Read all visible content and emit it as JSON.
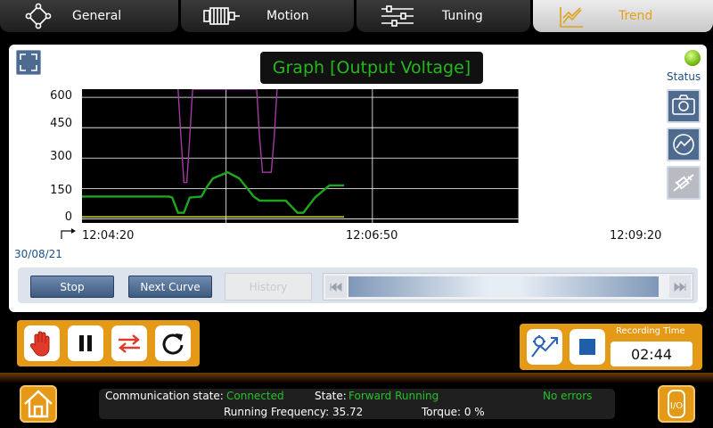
{
  "tabs": [
    {
      "label": "General",
      "icon": "network-icon"
    },
    {
      "label": "Motion",
      "icon": "motor-icon"
    },
    {
      "label": "Tuning",
      "icon": "sliders-icon"
    },
    {
      "label": "Trend",
      "icon": "trend-icon",
      "active": true
    }
  ],
  "graph": {
    "title": "Graph [Output Voltage]",
    "status_label": "Status",
    "date": "30/08/21"
  },
  "chart_data": {
    "type": "line",
    "yticks": [
      0,
      150,
      300,
      450,
      600
    ],
    "xticks": [
      "12:04:20",
      "12:06:50",
      "12:09:20"
    ],
    "ylim": [
      -20,
      640
    ],
    "xlim": [
      0,
      300
    ],
    "grid": true,
    "series": [
      {
        "color": "#1fa51f",
        "x": [
          0,
          60,
          62,
          66,
          70,
          74,
          82,
          86,
          90,
          100,
          108,
          118,
          122,
          132,
          140,
          148,
          152,
          160,
          170,
          180
        ],
        "y": [
          110,
          110,
          105,
          30,
          30,
          105,
          110,
          160,
          200,
          230,
          200,
          110,
          90,
          90,
          90,
          30,
          30,
          105,
          165,
          165
        ]
      },
      {
        "color": "#a43aa5",
        "x": [
          66,
          68,
          70,
          72,
          74,
          76,
          120,
          122,
          124,
          126,
          128,
          130,
          132,
          134
        ],
        "y": [
          640,
          400,
          180,
          180,
          400,
          640,
          640,
          400,
          230,
          230,
          230,
          230,
          400,
          640
        ]
      },
      {
        "color": "#e8e830",
        "x": [
          0,
          180
        ],
        "y": [
          10,
          10
        ]
      }
    ]
  },
  "controls": {
    "stop": "Stop",
    "next_curve": "Next Curve",
    "history": "History"
  },
  "recording": {
    "label": "Recording Time",
    "time": "02:44"
  },
  "status_bar": {
    "comm_label": "Communication state:",
    "comm_value": "Connected",
    "state_label": "State:",
    "state_value": "Forward Running",
    "errors": "No errors",
    "frequency": "Running Frequency: 35.72",
    "torque": "Torque:  0 %"
  },
  "colors": {
    "accent": "#e59a17",
    "active_tab_text": "#e2a11c",
    "status_ok": "#27c02a",
    "panel_blue": "#4e6a8e"
  }
}
